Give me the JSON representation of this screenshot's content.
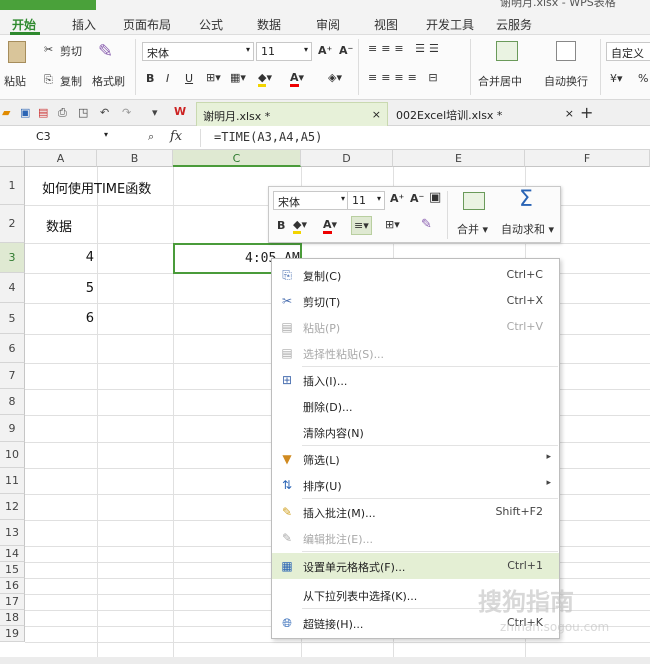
{
  "app": {
    "title_partial": "WPS 表格",
    "right_title": "谢明月.xlsx - WPS表格"
  },
  "menu": [
    "开始",
    "插入",
    "页面布局",
    "公式",
    "数据",
    "审阅",
    "视图",
    "开发工具",
    "云服务"
  ],
  "ribbon": {
    "paste": "粘贴",
    "cut": "剪切",
    "copy": "复制",
    "format_painter": "格式刷",
    "font_name": "宋体",
    "font_size": "11",
    "bold": "B",
    "italic": "I",
    "underline": "U",
    "merge_center": "合并居中",
    "wrap": "自动换行",
    "number_format": "自定义",
    "percent": "%",
    "font_grow": "A⁺",
    "font_shrink": "A⁻"
  },
  "doc_tabs": [
    {
      "label": "谢明月.xlsx *"
    },
    {
      "label": "002Excel培训.xlsx *"
    }
  ],
  "formula_bar": {
    "name_box": "C3",
    "fx": "fx",
    "formula": "=TIME(A3,A4,A5)"
  },
  "columns": [
    "A",
    "B",
    "C",
    "D",
    "E",
    "F"
  ],
  "rows": [
    "1",
    "2",
    "3",
    "4",
    "5",
    "6",
    "7",
    "8",
    "9",
    "10",
    "11",
    "12",
    "13",
    "14",
    "15",
    "16",
    "17",
    "18",
    "19"
  ],
  "cells": {
    "A1": "如何使用TIME函数",
    "A2": "数据",
    "A3": "4",
    "A4": "5",
    "A5": "6",
    "C3": "4:05 AM"
  },
  "mini_toolbar": {
    "font_name": "宋体",
    "font_size": "11",
    "bold": "B",
    "merge": "合并",
    "autosum": "自动求和"
  },
  "context_menu": [
    {
      "label": "复制(C)",
      "shortcut": "Ctrl+C",
      "icon": "copy-icon",
      "disabled": false
    },
    {
      "label": "剪切(T)",
      "shortcut": "Ctrl+X",
      "icon": "scissors-icon",
      "disabled": false
    },
    {
      "label": "粘贴(P)",
      "shortcut": "Ctrl+V",
      "icon": "paste-icon",
      "disabled": true
    },
    {
      "label": "选择性粘贴(S)...",
      "shortcut": "",
      "icon": "paste-special-icon",
      "disabled": true
    },
    {
      "label": "插入(I)...",
      "shortcut": "",
      "icon": "insert-icon",
      "disabled": false
    },
    {
      "label": "删除(D)...",
      "shortcut": "",
      "icon": "",
      "disabled": false
    },
    {
      "label": "清除内容(N)",
      "shortcut": "",
      "icon": "",
      "disabled": false
    },
    {
      "label": "筛选(L)",
      "shortcut": "",
      "icon": "filter-icon",
      "disabled": false,
      "submenu": true
    },
    {
      "label": "排序(U)",
      "shortcut": "",
      "icon": "sort-icon",
      "disabled": false,
      "submenu": true
    },
    {
      "label": "插入批注(M)...",
      "shortcut": "Shift+F2",
      "icon": "comment-icon",
      "disabled": false
    },
    {
      "label": "编辑批注(E)...",
      "shortcut": "",
      "icon": "edit-comment-icon",
      "disabled": true
    },
    {
      "label": "设置单元格格式(F)...",
      "shortcut": "Ctrl+1",
      "icon": "format-cells-icon",
      "disabled": false,
      "highlighted": true
    },
    {
      "label": "从下拉列表中选择(K)...",
      "shortcut": "",
      "icon": "",
      "disabled": false
    },
    {
      "label": "超链接(H)...",
      "shortcut": "Ctrl+K",
      "icon": "hyperlink-icon",
      "disabled": false
    }
  ],
  "watermark": {
    "main": "搜狗指南",
    "sub": "zhinan.sogou.com"
  },
  "colors": {
    "accent": "#4aa13a",
    "highlight": "#e4efd4",
    "selection": "#dfe9d2"
  }
}
